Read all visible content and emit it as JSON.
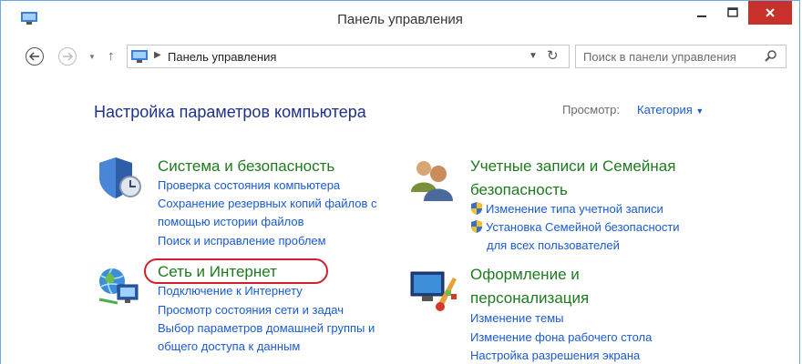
{
  "window": {
    "title": "Панель управления"
  },
  "address": {
    "path": "Панель управления"
  },
  "search": {
    "placeholder": "Поиск в панели управления"
  },
  "main": {
    "heading": "Настройка параметров компьютера",
    "view_label": "Просмотр:",
    "view_value": "Категория",
    "categories": [
      {
        "title": "Система и безопасность",
        "icon": "shield-icon",
        "links": [
          "Проверка состояния компьютера",
          "Сохранение резервных копий файлов с",
          "помощью истории файлов",
          "Поиск и исправление проблем"
        ]
      },
      {
        "title": "Сеть и Интернет",
        "icon": "network-icon",
        "links": [
          "Подключение к Интернету",
          "Просмотр состояния сети и задач",
          "Выбор параметров домашней группы и",
          "общего доступа к данным"
        ]
      },
      {
        "title_line1": "Учетные записи и Семейная",
        "title_line2": "безопасность",
        "icon": "users-icon",
        "links": [
          "Изменение типа учетной записи",
          "Установка Семейной безопасности",
          "для всех пользователей"
        ]
      },
      {
        "title_line1": "Оформление и",
        "title_line2": "персонализация",
        "icon": "appearance-icon",
        "links": [
          "Изменение темы",
          "Изменение фона рабочего стола",
          "Настройка разрешения экрана"
        ]
      }
    ]
  },
  "colors": {
    "category_title": "#1e7a1e",
    "link": "#1a5ad2",
    "heading": "#1e3287",
    "highlight": "#d0202a",
    "close_button": "#c7302b"
  }
}
